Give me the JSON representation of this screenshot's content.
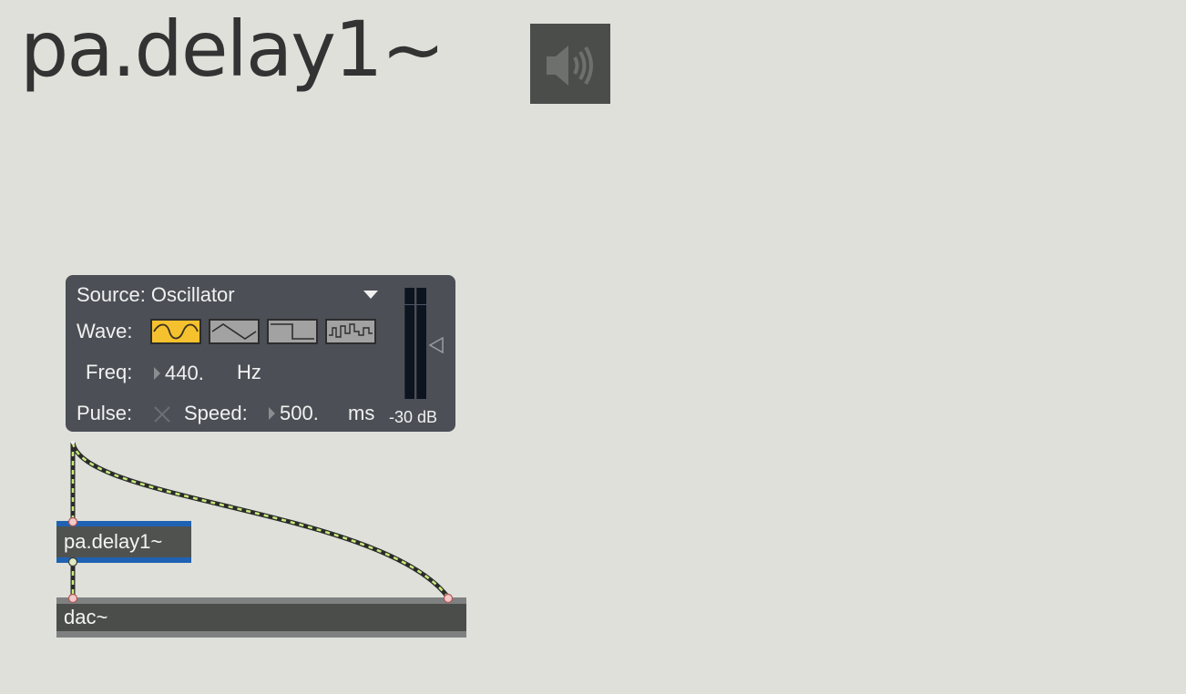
{
  "title": "pa.delay1~",
  "audio_toggle": {
    "icon": "speaker-icon",
    "state": "off"
  },
  "panel": {
    "source_label": "Source: Oscillator",
    "wave_label": "Wave:",
    "wave_buttons": [
      {
        "icon": "sine-wave-icon",
        "selected": true
      },
      {
        "icon": "triangle-wave-icon",
        "selected": false
      },
      {
        "icon": "square-wave-icon",
        "selected": false
      },
      {
        "icon": "noise-wave-icon",
        "selected": false
      }
    ],
    "freq_label": "Freq:",
    "freq_value": "440.",
    "freq_unit": "Hz",
    "pulse_label": "Pulse:",
    "speed_label": "Speed:",
    "speed_value": "500.",
    "speed_unit": "ms",
    "meter_label": "-30 dB"
  },
  "objects": {
    "delay": "pa.delay1~",
    "dac": "dac~"
  },
  "colors": {
    "background": "#dfe0da",
    "panel": "#4c4f55",
    "selected_wave": "#f5c12e",
    "selection_outline": "#1f62b3",
    "patchcord": "#c7ea7a"
  }
}
